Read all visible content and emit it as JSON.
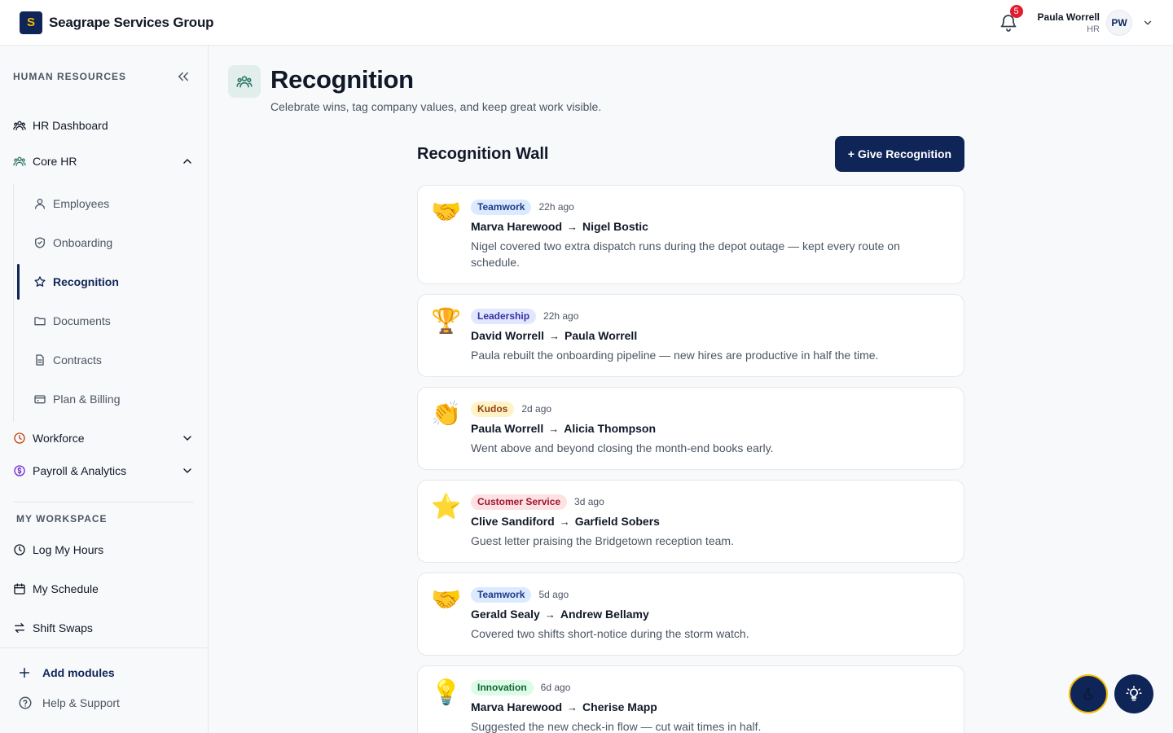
{
  "header": {
    "logo_letter": "S",
    "company": "Seagrape Services Group",
    "notification_count": "5",
    "user_name": "Paula Worrell",
    "user_role": "HR",
    "user_initials": "PW"
  },
  "sidebar": {
    "section_title": "HUMAN RESOURCES",
    "dashboard": "HR Dashboard",
    "core_hr": "Core HR",
    "core_items": [
      "Employees",
      "Onboarding",
      "Recognition",
      "Documents",
      "Contracts",
      "Plan & Billing"
    ],
    "active_item": "Recognition",
    "workforce": "Workforce",
    "payroll": "Payroll & Analytics",
    "workspace_title": "MY WORKSPACE",
    "workspace_items": [
      "Log My Hours",
      "My Schedule",
      "Shift Swaps"
    ],
    "add_modules": "Add modules",
    "help": "Help & Support"
  },
  "page": {
    "title": "Recognition",
    "subtitle": "Celebrate wins, tag company values, and keep great work visible."
  },
  "wall": {
    "title": "Recognition Wall",
    "give_button": "+ Give Recognition",
    "cards": [
      {
        "emoji": "🤝",
        "tag": "Teamwork",
        "time": "22h ago",
        "from": "Marva Harewood",
        "arrow": "→",
        "to": "Nigel Bostic",
        "message": "Nigel covered two extra dispatch runs during the depot outage — kept every route on schedule."
      },
      {
        "emoji": "🏆",
        "tag": "Leadership",
        "time": "22h ago",
        "from": "David Worrell",
        "arrow": "→",
        "to": "Paula Worrell",
        "message": "Paula rebuilt the onboarding pipeline — new hires are productive in half the time."
      },
      {
        "emoji": "👏",
        "tag": "Kudos",
        "time": "2d ago",
        "from": "Paula Worrell",
        "arrow": "→",
        "to": "Alicia Thompson",
        "message": "Went above and beyond closing the month-end books early."
      },
      {
        "emoji": "⭐",
        "tag": "Customer Service",
        "time": "3d ago",
        "from": "Clive Sandiford",
        "arrow": "→",
        "to": "Garfield Sobers",
        "message": "Guest letter praising the Bridgetown reception team."
      },
      {
        "emoji": "🤝",
        "tag": "Teamwork",
        "time": "5d ago",
        "from": "Gerald Sealy",
        "arrow": "→",
        "to": "Andrew Bellamy",
        "message": "Covered two shifts short-notice during the storm watch."
      },
      {
        "emoji": "💡",
        "tag": "Innovation",
        "time": "6d ago",
        "from": "Marva Harewood",
        "arrow": "→",
        "to": "Cherise Mapp",
        "message": "Suggested the new check-in flow — cut wait times in half."
      }
    ]
  },
  "tag_colors": {
    "Teamwork": {
      "bg": "#dbeafe",
      "fg": "#1e3a8a"
    },
    "Leadership": {
      "bg": "#e0e7ff",
      "fg": "#3730a3"
    },
    "Kudos": {
      "bg": "#fef3c7",
      "fg": "#92400e"
    },
    "Customer Service": {
      "bg": "#fee2e2",
      "fg": "#9f1239"
    },
    "Innovation": {
      "bg": "#dcfce7",
      "fg": "#166534"
    }
  },
  "colors": {
    "brand": "#0f2557",
    "accent": "#f5b800",
    "badge": "#e11d2e"
  },
  "icons": {
    "floating_left": "accessibility-icon",
    "floating_right": "lightbulb-icon"
  }
}
